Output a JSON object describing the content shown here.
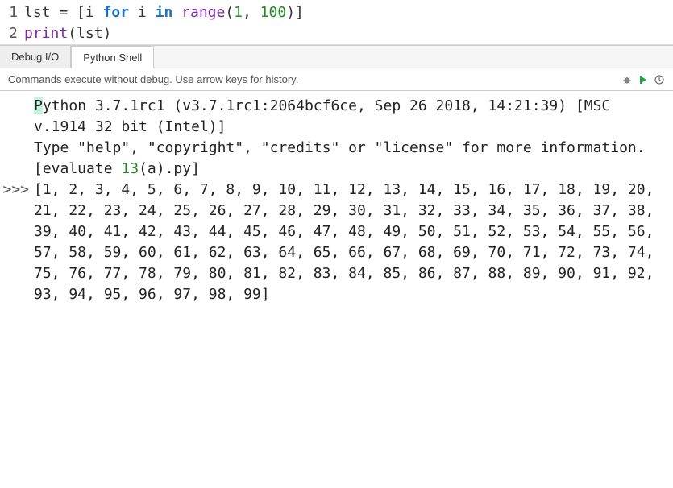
{
  "editor": {
    "lines": [
      1,
      2
    ],
    "code": {
      "line1": {
        "lst": "lst",
        "eq": " = [",
        "i": "i",
        "for": "for",
        "i2": "i",
        "in": "in",
        "range": "range",
        "args_open": "(",
        "arg1": "1",
        "comma": ", ",
        "arg2": "100",
        "args_close": ")]"
      },
      "line2": {
        "print": "print",
        "open": "(",
        "lst": "lst",
        "close": ")"
      }
    }
  },
  "tabs": {
    "debug": "Debug I/O",
    "shell": "Python Shell"
  },
  "infobar": {
    "hint": "Commands execute without debug.  Use arrow keys for history."
  },
  "shell": {
    "prompt": ">>>",
    "banner1": "ython 3.7.1rc1 (v3.7.1rc1:2064bcf6ce, Sep 26 2018, 14:21:39) [MSC v.1914 32 bit (Intel)]",
    "banner1_first": "P",
    "banner2": "Type \"help\", \"copyright\", \"credits\" or \"license\" for more information.",
    "eval_open": "[evaluate ",
    "eval_num": "13",
    "eval_rest": "(a).py]",
    "output": "[1, 2, 3, 4, 5, 6, 7, 8, 9, 10, 11, 12, 13, 14, 15, 16, 17, 18, 19, 20, 21, 22, 23, 24, 25, 26, 27, 28, 29, 30, 31, 32, 33, 34, 35, 36, 37, 38, 39, 40, 41, 42, 43, 44, 45, 46, 47, 48, 49, 50, 51, 52, 53, 54, 55, 56, 57, 58, 59, 60, 61, 62, 63, 64, 65, 66, 67, 68, 69, 70, 71, 72, 73, 74, 75, 76, 77, 78, 79, 80, 81, 82, 83, 84, 85, 86, 87, 88, 89, 90, 91, 92, 93, 94, 95, 96, 97, 98, 99]"
  }
}
